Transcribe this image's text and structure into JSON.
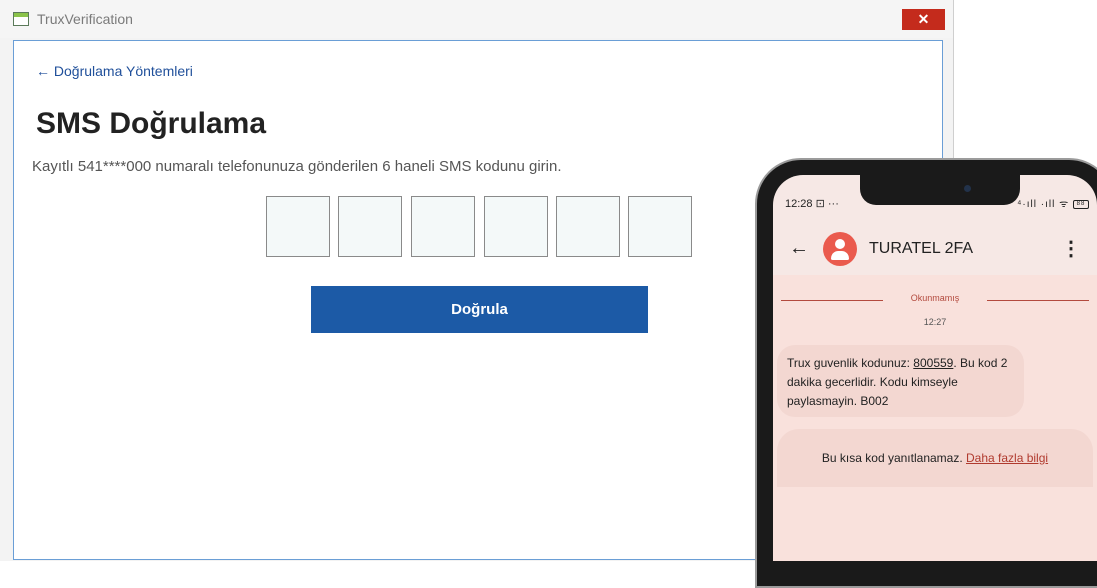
{
  "window": {
    "title": "TruxVerification",
    "close_symbol": "✕"
  },
  "page": {
    "back_link": "← Doğrulama Yöntemleri",
    "title": "SMS Doğrulama",
    "subtitle": "Kayıtlı 541****000 numaralı telefonunuza gönderilen 6 haneli SMS kodunu girin.",
    "code_digits": [
      "",
      "",
      "",
      "",
      "",
      ""
    ],
    "verify_button": "Doğrula"
  },
  "phone": {
    "status_time": "12:28",
    "status_extra": "⊡ ···",
    "status_icons": "⁴·ıll ·ıll ᯤ",
    "battery": "88",
    "sender": "TURATEL 2FA",
    "unread_label": "Okunmamış",
    "message_time": "12:27",
    "message_pre": "Trux guvenlik kodunuz: ",
    "message_code": "800559",
    "message_post": ". Bu kod 2 dakika gecerlidir. Kodu kimseyle paylasmayin. B002",
    "reply_notice": "Bu kısa kod yanıtlanamaz. ",
    "more_info": "Daha fazla bilgi"
  },
  "colors": {
    "accent": "#1c5aa6",
    "close_red": "#c42b1c",
    "avatar": "#ea5a4d",
    "link_red": "#b03a2e"
  },
  "icons": {
    "app": "window-app-icon",
    "close": "close-icon",
    "back": "arrow-left-icon",
    "avatar": "person-avatar-icon",
    "more": "more-vertical-icon"
  }
}
